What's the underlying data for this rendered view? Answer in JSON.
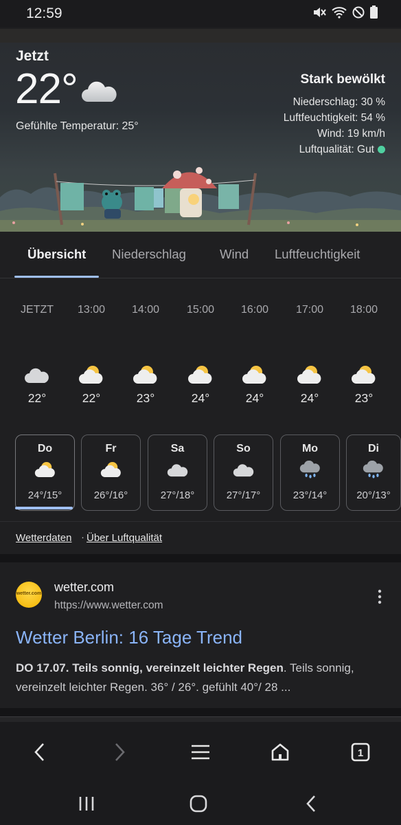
{
  "status_bar": {
    "time": "12:59"
  },
  "current": {
    "label": "Jetzt",
    "temp": "22°",
    "feels_like": "Gefühlte Temperatur: 25°",
    "condition": "Stark bewölkt",
    "precipitation": "Niederschlag: 30 %",
    "humidity": "Luftfeuchtigkeit: 54 %",
    "wind": "Wind: 19 km/h",
    "air_quality": "Luftqualität: Gut",
    "air_quality_color": "#4fd0a0"
  },
  "tabs": [
    "Übersicht",
    "Niederschlag",
    "Wind",
    "Luftfeuchtigkeit"
  ],
  "hourly": [
    {
      "time": "JETZT",
      "temp": "22°",
      "icon": "cloudy-icon"
    },
    {
      "time": "13:00",
      "temp": "22°",
      "icon": "partly-sunny-icon"
    },
    {
      "time": "14:00",
      "temp": "23°",
      "icon": "partly-sunny-icon"
    },
    {
      "time": "15:00",
      "temp": "24°",
      "icon": "partly-sunny-icon"
    },
    {
      "time": "16:00",
      "temp": "24°",
      "icon": "partly-sunny-icon"
    },
    {
      "time": "17:00",
      "temp": "24°",
      "icon": "partly-sunny-icon"
    },
    {
      "time": "18:00",
      "temp": "23°",
      "icon": "partly-sunny-icon"
    }
  ],
  "daily": [
    {
      "day": "Do",
      "temps": "24°/15°",
      "icon": "partly-sunny-icon"
    },
    {
      "day": "Fr",
      "temps": "26°/16°",
      "icon": "partly-sunny-icon"
    },
    {
      "day": "Sa",
      "temps": "27°/18°",
      "icon": "cloudy-icon"
    },
    {
      "day": "So",
      "temps": "27°/17°",
      "icon": "cloudy-icon"
    },
    {
      "day": "Mo",
      "temps": "23°/14°",
      "icon": "rain-icon"
    },
    {
      "day": "Di",
      "temps": "20°/13°",
      "icon": "rain-icon"
    }
  ],
  "links": {
    "weather_data": "Wetterdaten",
    "separator": "·",
    "air_quality": "Über Luftqualität"
  },
  "result": {
    "logo_text": "wetter.com",
    "site_name": "wetter.com",
    "url": "https://www.wetter.com",
    "title": "Wetter Berlin: 16 Tage Trend",
    "snippet_bold": "DO 17.07. Teils sonnig, vereinzelt leichter Regen",
    "snippet_rest": ". Teils sonnig, vereinzelt leichter Regen. 36° / 26°. gefühlt 40°/ 28 ..."
  },
  "toolbar": {
    "tabs_count": "1"
  },
  "colors": {
    "accent": "#9fbff3",
    "link": "#8ab4f8",
    "background": "#1f1f21"
  }
}
